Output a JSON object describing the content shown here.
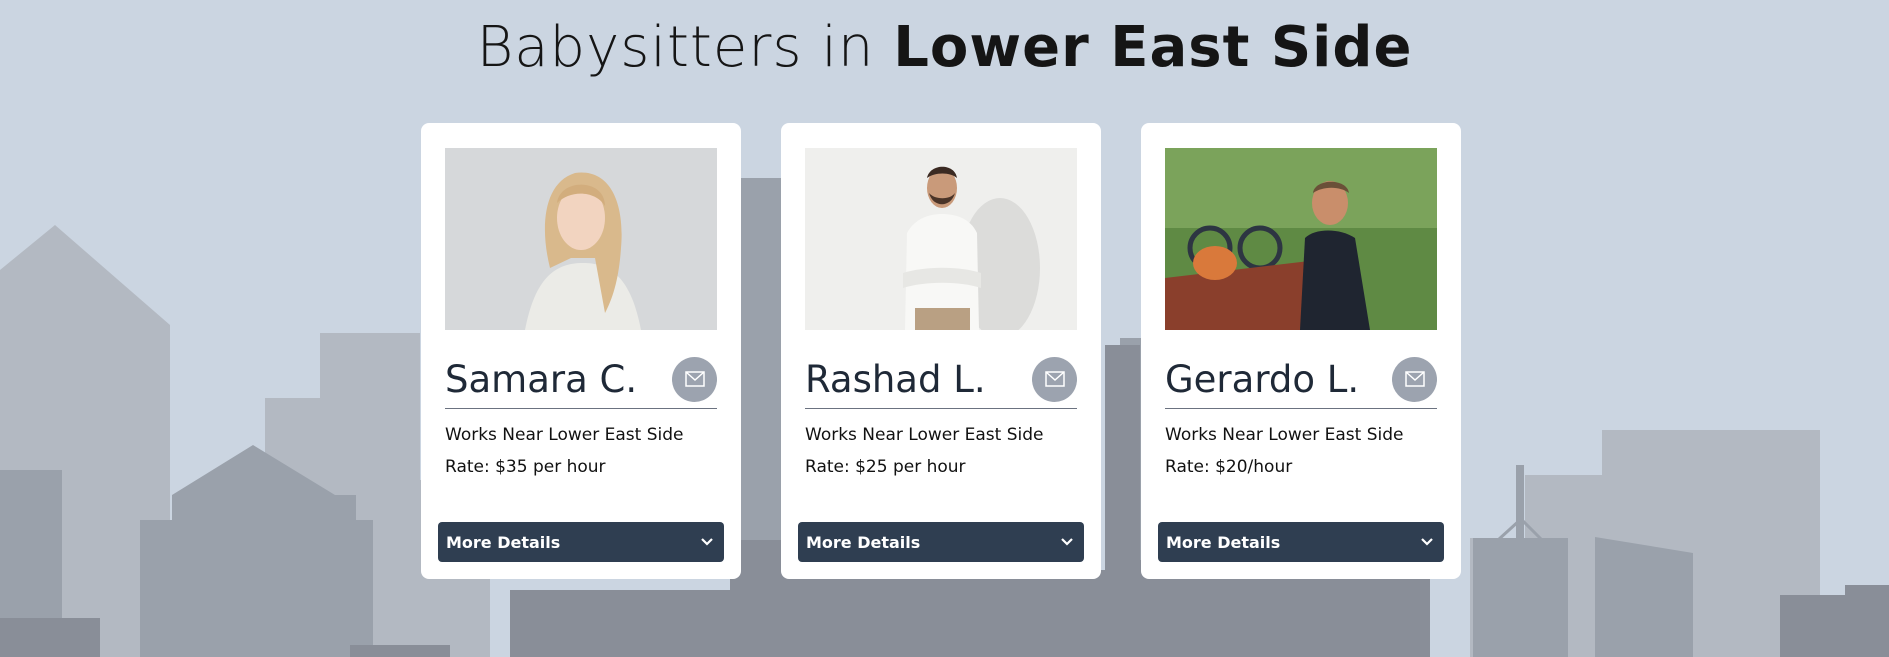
{
  "heading": {
    "prefix": "Babysitters in",
    "location": "Lower East Side"
  },
  "sitters": [
    {
      "name": "Samara C.",
      "works_near": "Works Near Lower East Side",
      "rate": "Rate: $35 per hour",
      "details_label": "More Details",
      "photo": "woman-portrait-grey-background"
    },
    {
      "name": "Rashad L.",
      "works_near": "Works Near Lower East Side",
      "rate": "Rate: $25 per hour",
      "details_label": "More Details",
      "photo": "man-with-glasses-arms-crossed"
    },
    {
      "name": "Gerardo L.",
      "works_near": "Works Near Lower East Side",
      "rate": "Rate: $20/hour",
      "details_label": "More Details",
      "photo": "man-at-picnic-table-with-bikes"
    }
  ],
  "icons": {
    "message": "envelope-icon",
    "expand": "chevron-down-icon"
  },
  "colors": {
    "background": "#cbd5e1",
    "button": "#2f3e51",
    "message_button": "#9ca3af"
  }
}
